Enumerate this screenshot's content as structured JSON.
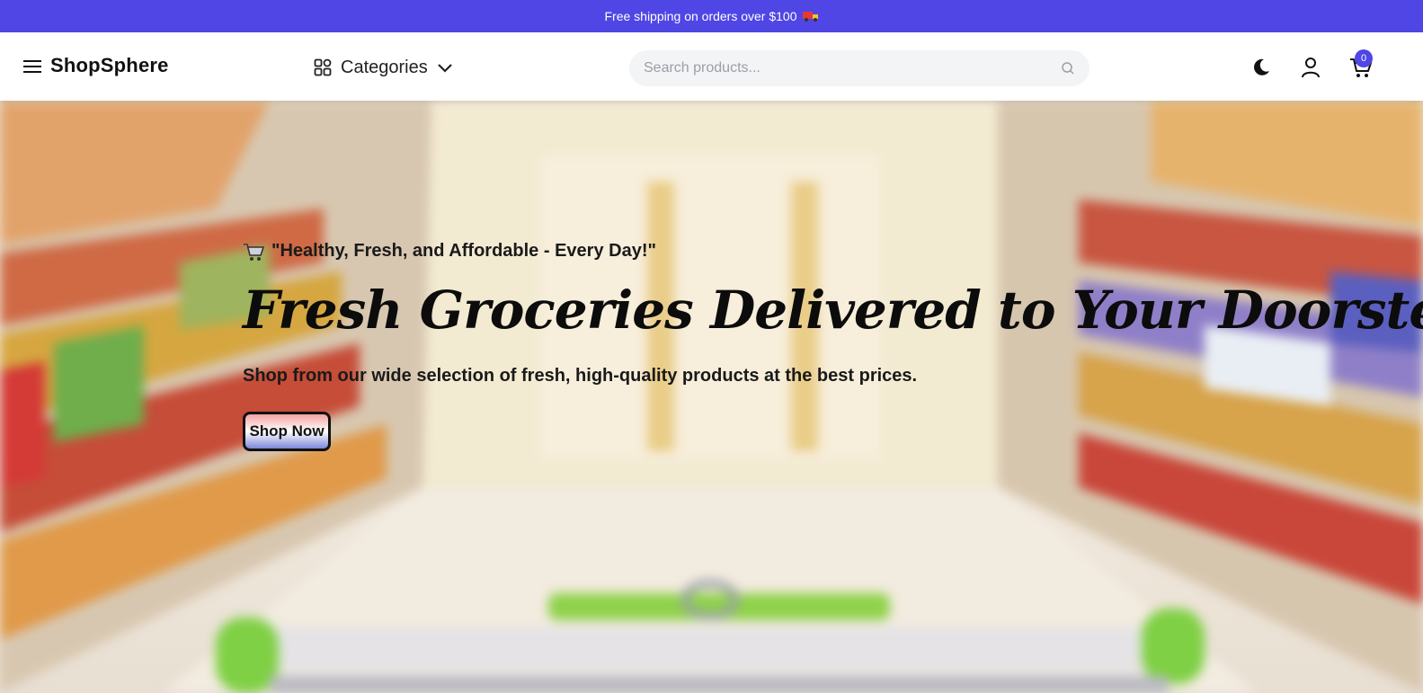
{
  "promo": {
    "text": "Free shipping on orders over $100",
    "icon": "truck-icon"
  },
  "header": {
    "brand": "ShopSphere",
    "categories_label": "Categories",
    "search_placeholder": "Search products...",
    "cart_count": "0",
    "accent_color": "#4f46e5"
  },
  "hero": {
    "tagline": "\"Healthy, Fresh, and Affordable - Every Day!\"",
    "title": "Fresh Groceries Delivered to Your Doorstep",
    "subtitle": "Shop from our wide selection of fresh, high-quality products at the best prices.",
    "cta_label": "Shop Now"
  }
}
